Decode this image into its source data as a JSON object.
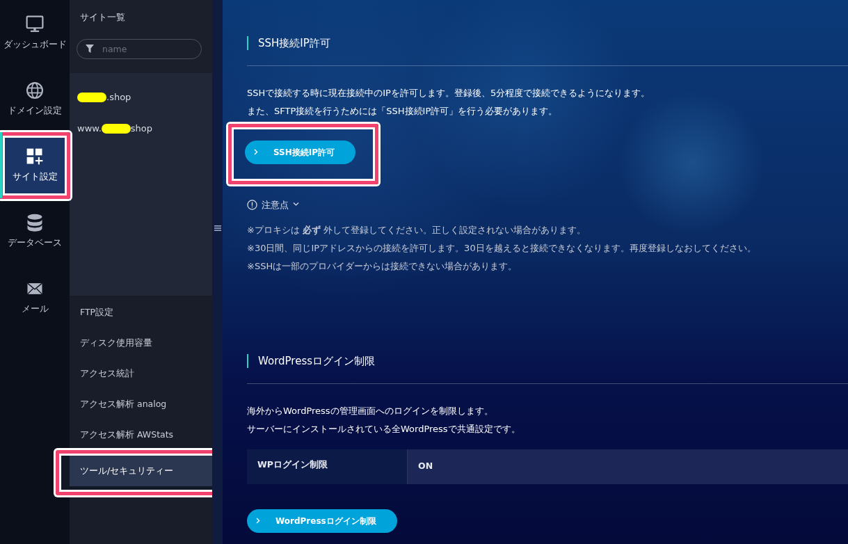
{
  "nav_rail": {
    "items": [
      {
        "label": "ダッシュボード",
        "selected": false,
        "highlighted": false
      },
      {
        "label": "ドメイン設定",
        "selected": false,
        "highlighted": false
      },
      {
        "label": "サイト設定",
        "selected": true,
        "highlighted": true
      },
      {
        "label": "データベース",
        "selected": false,
        "highlighted": false
      },
      {
        "label": "メール",
        "selected": false,
        "highlighted": false
      }
    ]
  },
  "site_panel": {
    "title": "サイト一覧",
    "filter": {
      "placeholder": "name"
    },
    "sites": [
      {
        "parts": [
          {
            "kind": "redaction"
          },
          {
            "kind": "text",
            "text": ".shop"
          }
        ]
      },
      {
        "parts": [
          {
            "kind": "text",
            "text": "www."
          },
          {
            "kind": "redaction"
          },
          {
            "kind": "text",
            "text": "shop"
          }
        ]
      }
    ],
    "menu": [
      {
        "label": "FTP設定",
        "selected": false,
        "highlighted": false
      },
      {
        "label": "ディスク使用容量",
        "selected": false,
        "highlighted": false
      },
      {
        "label": "アクセス統計",
        "selected": false,
        "highlighted": false
      },
      {
        "label": "アクセス解析 analog",
        "selected": false,
        "highlighted": false
      },
      {
        "label": "アクセス解析 AWStats",
        "selected": false,
        "highlighted": false
      },
      {
        "label": "ツール/セキュリティー",
        "selected": true,
        "highlighted": true
      }
    ]
  },
  "sections": [
    {
      "title": "SSH接続IP許可",
      "paragraphs": [
        "SSHで接続する時に現在接続中のIPを許可します。登録後、5分程度で接続できるようになります。",
        "また、SFTP接続を行うためには「SSH接続IP許可」を行う必要があります。"
      ],
      "button": {
        "label": "SSH接続IP許可",
        "highlighted": true
      },
      "notes": {
        "label": "注意点",
        "expanded": true,
        "items": [
          "※プロキシは **必ず** 外して登録してください。正しく設定されない場合があります。",
          "※30日間、同じIPアドレスからの接続を許可します。30日を越えると接続できなくなります。再度登録しなおしてください。",
          "※SSHは一部のプロバイダーからは接続できない場合があります。"
        ]
      }
    },
    {
      "title": "WordPressログイン制限",
      "paragraphs": [
        "海外からWordPressの管理画面へのログインを制限します。",
        "サーバーにインストールされている全WordPressで共通設定です。"
      ],
      "table": [
        {
          "label": "WPログイン制限",
          "value": "ON"
        }
      ],
      "button": {
        "label": "WordPressログイン制限"
      }
    }
  ]
}
